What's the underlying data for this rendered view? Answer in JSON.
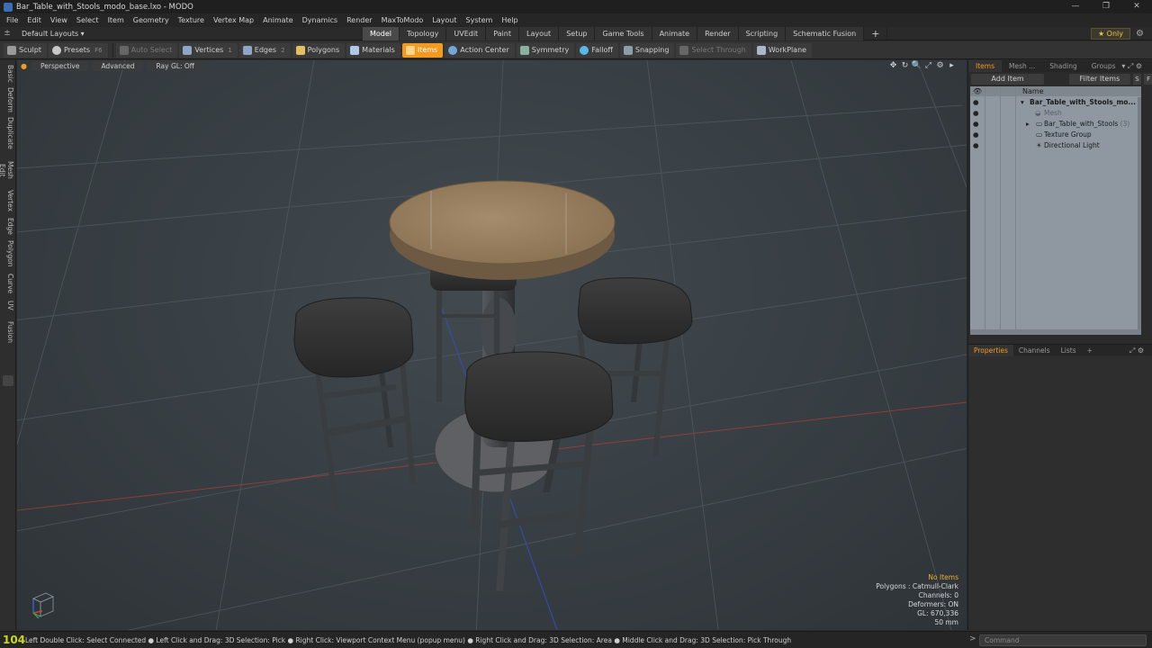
{
  "window": {
    "title": "Bar_Table_with_Stools_modo_base.lxo - MODO",
    "controls": [
      "—",
      "❐",
      "✕"
    ]
  },
  "menu": [
    "File",
    "Edit",
    "View",
    "Select",
    "Item",
    "Geometry",
    "Texture",
    "Vertex Map",
    "Animate",
    "Dynamics",
    "Render",
    "MaxToModo",
    "Layout",
    "System",
    "Help"
  ],
  "layout_bar": {
    "layouts_label": "Default Layouts ▾",
    "tabs": [
      "Model",
      "Topology",
      "UVEdit",
      "Paint",
      "Layout",
      "Setup",
      "Game Tools",
      "Animate",
      "Render",
      "Scripting",
      "Schematic Fusion"
    ],
    "active_tab": "Model",
    "plus": "+",
    "only_label": "★  Only",
    "gear": "⚙"
  },
  "toolbar": {
    "sculpt": "Sculpt",
    "presets": "Presets",
    "presets_key": "F6",
    "auto_select": "Auto Select",
    "vertices": "Vertices",
    "vertices_key": "1",
    "edges": "Edges",
    "edges_key": "2",
    "polygons": "Polygons",
    "materials": "Materials",
    "items": "Items",
    "action_center": "Action Center",
    "symmetry": "Symmetry",
    "falloff": "Falloff",
    "snapping": "Snapping",
    "select_through": "Select Through",
    "workplane": "WorkPlane"
  },
  "left_tabs": [
    "Basic",
    "Deform",
    "Duplicate",
    "Mesh Edit",
    "Vertex",
    "Edge",
    "Polygon",
    "Curve",
    "UV",
    "Fusion"
  ],
  "viewport": {
    "menu_dot": "●",
    "view_mode": "Perspective",
    "shading": "Advanced",
    "ray_gl": "Ray GL: Off",
    "icons": [
      "✥",
      "↻",
      "🔍",
      "⤢",
      "⚙",
      "▸"
    ],
    "info": {
      "selection": "No Items",
      "polygons": "Polygons : Catmull-Clark",
      "channels": "Channels: 0",
      "deformers": "Deformers: ON",
      "gl": "GL: 670,336",
      "lens": "50 mm"
    }
  },
  "items_panel": {
    "tabs": [
      "Items",
      "Mesh ...",
      "Shading",
      "Groups"
    ],
    "active_tab": "Items",
    "add_item": "Add Item",
    "filter_items": "Filter Items",
    "btn_s": "S",
    "btn_f": "F",
    "column_name": "Name",
    "rows": [
      {
        "label": "Bar_Table_with_Stools_mo...",
        "type": "scene"
      },
      {
        "label": "Mesh",
        "type": "mesh"
      },
      {
        "label": "Bar_Table_with_Stools",
        "count": "(3)",
        "type": "group"
      },
      {
        "label": "Texture Group",
        "type": "texture"
      },
      {
        "label": "Directional Light",
        "type": "light"
      }
    ]
  },
  "properties_panel": {
    "tabs": [
      "Properties",
      "Channels",
      "Lists"
    ],
    "active_tab": "Properties",
    "plus": "+"
  },
  "status": {
    "fps": "104",
    "hint": "Left Double Click: Select Connected ● Left Click and Drag: 3D Selection: Pick ● Right Click: Viewport Context Menu (popup menu) ● Right Click and Drag: 3D Selection: Area ● Middle Click and Drag: 3D Selection: Pick Through",
    "command_placeholder": "Command",
    "arrow": ">"
  }
}
